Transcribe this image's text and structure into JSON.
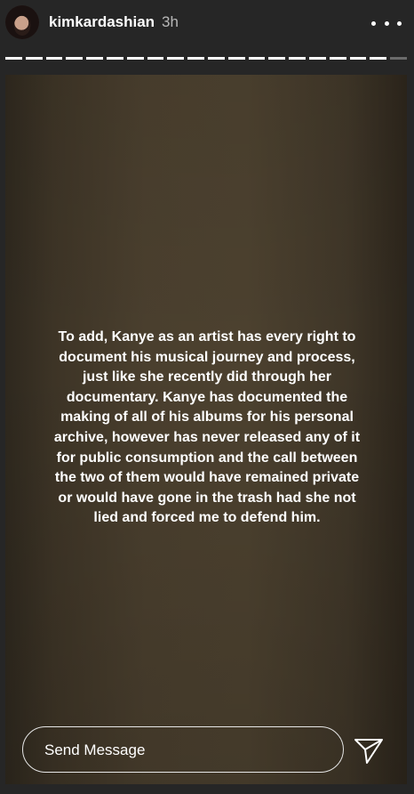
{
  "header": {
    "username": "kimkardashian",
    "timestamp": "3h",
    "avatar_icon": "profile-avatar",
    "more_icon": "more-horizontal-icon"
  },
  "progress": {
    "segments": 20,
    "viewed": 19,
    "active_color": "#ffffff",
    "inactive_color": "#6b6b6b"
  },
  "story": {
    "text": "To add, Kanye as an artist has every right to document his musical journey and process, just like she recently did through her documentary. Kanye has documented the making of all of his albums for his personal archive, however has never released any of it for public consumption and the call between the two of them would have remained private or would have gone in the trash had she not lied and forced me to defend him.",
    "lines": [
      "To add, Kanye as an artist has every right to",
      "document his musical journey and process,",
      "just like she recently did through her",
      "documentary. Kanye has documented the",
      "making of all of his albums for his personal",
      "archive, however has never released any of it",
      "for public consumption and the call between",
      "the two of them would have remained private",
      "or would have gone in the trash had she not",
      "lied and forced me to defend him."
    ]
  },
  "reply": {
    "placeholder": "Send Message",
    "send_icon": "send-paper-plane-icon"
  },
  "colors": {
    "background": "#262626",
    "text": "#ffffff",
    "timestamp": "#b8b8b8"
  }
}
